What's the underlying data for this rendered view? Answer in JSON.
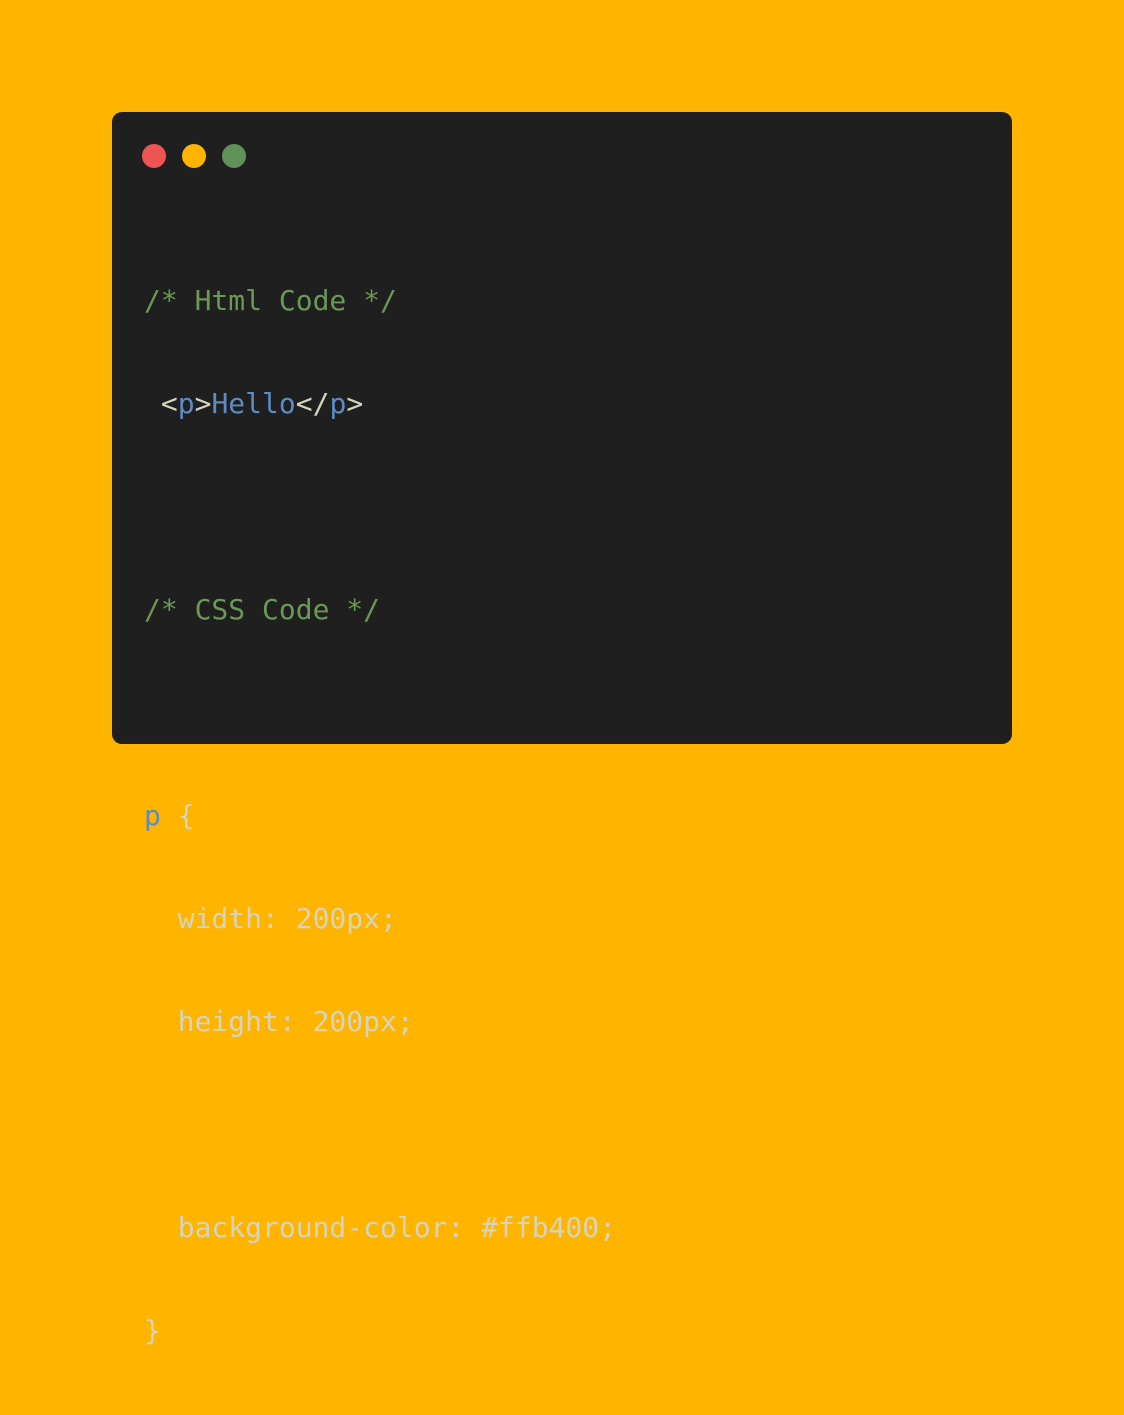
{
  "colors": {
    "background": "#ffb400",
    "window": "#1f1f1f",
    "dot_red": "#ee5552",
    "dot_yellow": "#ffb400",
    "dot_green": "#5f9158",
    "comment": "#6a9955",
    "tag": "#5b8cc4",
    "plain": "#d4d4c0"
  },
  "code": {
    "html_comment": "/* Html Code */",
    "html_line": {
      "indent": " ",
      "open_lt": "<",
      "open_tag": "p",
      "open_gt": ">",
      "content": "Hello",
      "close_lt": "</",
      "close_tag": "p",
      "close_gt": ">"
    },
    "css_comment": "/* CSS Code */",
    "selector": "p",
    "open_brace": " {",
    "width_decl": "  width: 200px;",
    "height_decl": "  height: 200px;",
    "bg_decl": "  background-color: #ffb400;",
    "close_brace": "}"
  }
}
